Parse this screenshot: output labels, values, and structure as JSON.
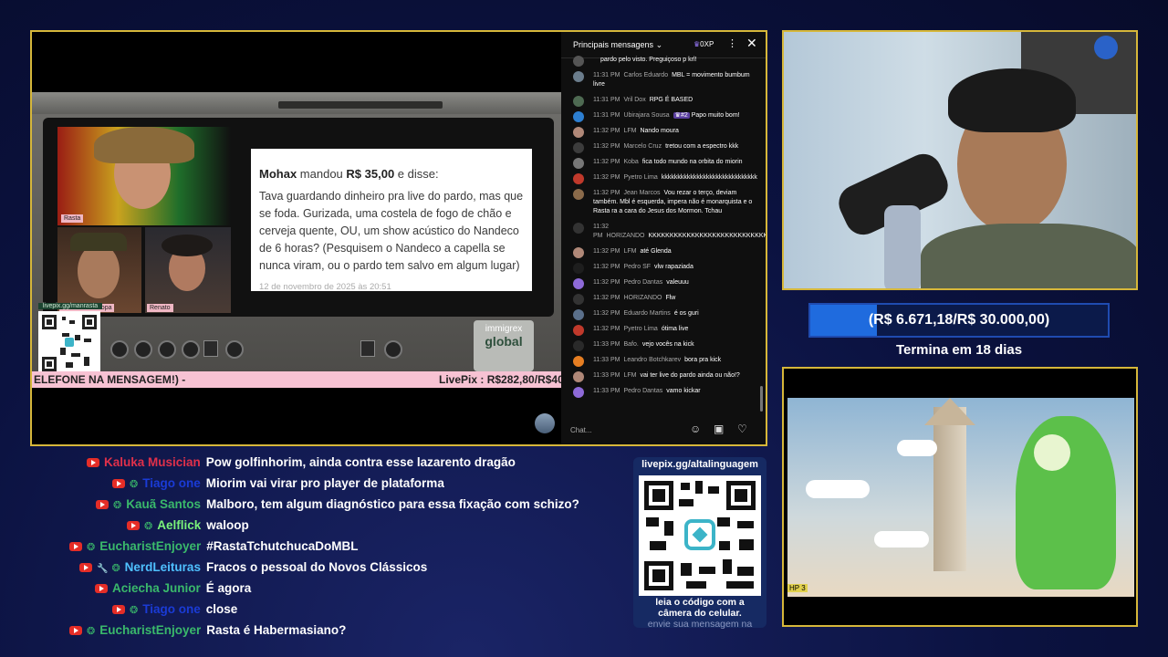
{
  "donation": {
    "sender": "Mohax",
    "verb": "mandou",
    "amount": "R$ 35,00",
    "suffix": "e disse:",
    "message": "Tava guardando dinheiro pra live do pardo, mas que se foda. Gurizada, uma costela de fogo de chão e cerveja quente, OU, um show acústico do Nandeco de 6 horas? (Pesquisem o Nandeco a capella se nunca viram, ou o pardo tem salvo em algum lugar)",
    "date": "12 de novembro de 2025 às 20:51"
  },
  "cams": {
    "cam1_label": "Rasta",
    "cam2_label": "Embaixador Jopa",
    "cam3_label": "Renato"
  },
  "livepix_small": "livepix.gg/manrasta",
  "immigrex": {
    "top": "immigrex",
    "bottom": "global"
  },
  "ticker": {
    "left": "ELEFONE NA MENSAGEM!) -",
    "right": "LivePix : R$282,80/R$40"
  },
  "chat": {
    "title": "Principais mensagens",
    "xp": "0XP",
    "input_placeholder": "Chat...",
    "messages": [
      {
        "time": "",
        "author": "",
        "text": "pardo pelo visto. Preguiçoso p krl!",
        "color": "#555"
      },
      {
        "time": "11:31 PM",
        "author": "Carlos Eduardo",
        "text": "MBL = movimento bumbum livre",
        "color": "#6b7d8c"
      },
      {
        "time": "11:31 PM",
        "author": "Vril Dox",
        "text": "RPG É BASED",
        "color": "#4e6a52"
      },
      {
        "time": "11:31 PM",
        "author": "Ubirajara Sousa",
        "badge": "#2",
        "text": "Papo muito bom!",
        "color": "#2d7fd1"
      },
      {
        "time": "11:32 PM",
        "author": "LFM",
        "text": "Nando moura",
        "color": "#b08878"
      },
      {
        "time": "11:32 PM",
        "author": "Marcelo Cruz",
        "text": "tretou com a espectro kkk",
        "color": "#3c3c3c"
      },
      {
        "time": "11:32 PM",
        "author": "Koba",
        "text": "fica todo mundo na orbita do miorin",
        "color": "#777"
      },
      {
        "time": "11:32 PM",
        "author": "Pyetro Lima",
        "text": "kkkkkkkkkkkkkkkkkkkkkkkkkkkkkk",
        "color": "#c0392b"
      },
      {
        "time": "11:32 PM",
        "author": "Jean Marcos",
        "text": "Vou rezar o terço, deviam também. Mbl é esquerda, impera não é monarquista e o Rasta ra a cara do Jesus dos Mormon. Tchau",
        "color": "#8a6a4a"
      },
      {
        "time": "11:32 PM",
        "author": "HORIZANDO",
        "text": "KKKKKKKKKKKKKKKKKKKKKKKKKKKKKKKKKKKKKKKKK",
        "color": "#333"
      },
      {
        "time": "11:32 PM",
        "author": "LFM",
        "text": "até Glenda",
        "color": "#b08878"
      },
      {
        "time": "11:32 PM",
        "author": "Pedro SF",
        "text": "vlw rapaziada",
        "color": "#1e1e1e"
      },
      {
        "time": "11:32 PM",
        "author": "Pedro Dantas",
        "text": "valeuuu",
        "color": "#8e6ad8"
      },
      {
        "time": "11:32 PM",
        "author": "HORIZANDO",
        "text": "Flw",
        "color": "#333"
      },
      {
        "time": "11:32 PM",
        "author": "Eduardo Martins",
        "text": "é os guri",
        "color": "#5a6f8a"
      },
      {
        "time": "11:32 PM",
        "author": "Pyetro Lima",
        "text": "ótima live",
        "color": "#c0392b"
      },
      {
        "time": "11:33 PM",
        "author": "Bafo.",
        "text": "vejo vocês na kick",
        "color": "#2a2a2a"
      },
      {
        "time": "11:33 PM",
        "author": "Leandro Botchkarev",
        "text": "bora pra kick",
        "color": "#e67e22"
      },
      {
        "time": "11:33 PM",
        "author": "LFM",
        "text": "vai ter live do pardo ainda ou não!?",
        "color": "#b08878"
      },
      {
        "time": "11:33 PM",
        "author": "Pedro Dantas",
        "text": "vamo kickar",
        "color": "#8e6ad8"
      }
    ]
  },
  "goal": {
    "text": "(R$ 6.671,18/R$ 30.000,00)",
    "progress": 0.2224,
    "ends": "Termina em 18 dias"
  },
  "game": {
    "hp": "HP 3"
  },
  "qr": {
    "url": "livepix.gg/altalinguagem",
    "line1": "leia o código com a",
    "line2": "câmera do celular.",
    "line3": "envie sua mensagem na"
  },
  "ytchat": [
    {
      "name": "Kaluka Musician",
      "color": "#e0304a",
      "icons": "yt",
      "text": "Pow golfinhorim, ainda contra esse lazarento dragão"
    },
    {
      "name": "Tiago one",
      "color": "#1a3bd6",
      "icons": "yt-g",
      "text": "Miorim vai virar pro player de plataforma"
    },
    {
      "name": "Kauã Santos",
      "color": "#3ab96b",
      "icons": "yt-g",
      "text": "Malboro, tem algum diagnóstico para essa fixação com schizo?"
    },
    {
      "name": "Aelflick",
      "color": "#7af27a",
      "icons": "yt-g",
      "text": "waloop"
    },
    {
      "name": "EucharistEnjoyer",
      "color": "#3ab96b",
      "icons": "yt-g",
      "text": "#RastaTchutchucaDoMBL"
    },
    {
      "name": "NerdLeituras",
      "color": "#4fc0ff",
      "icons": "yt-w-g",
      "text": "Fracos o pessoal do Novos Clássicos"
    },
    {
      "name": "Aciecha Junior",
      "color": "#3ab96b",
      "icons": "yt",
      "text": "É agora"
    },
    {
      "name": "Tiago one",
      "color": "#1a3bd6",
      "icons": "yt-g",
      "text": "close"
    },
    {
      "name": "EucharistEnjoyer",
      "color": "#3ab96b",
      "icons": "yt-g",
      "text": "Rasta é Habermasiano?"
    }
  ]
}
